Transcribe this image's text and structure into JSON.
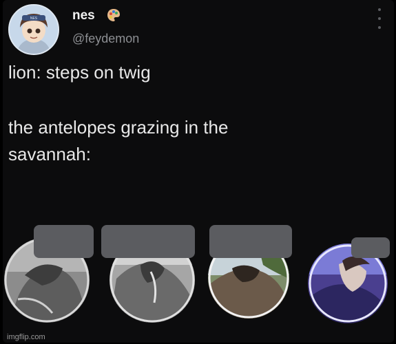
{
  "tweet": {
    "display_name": "nes",
    "name_emoji_icon": "artist-palette-icon",
    "handle": "@feydemon",
    "text_lines": [
      "lion: steps on twig",
      "the antelopes grazing in the",
      "savannah:"
    ]
  },
  "media": {
    "images": [
      {
        "name": "antelope-photo-1",
        "tone": "grayscale"
      },
      {
        "name": "antelope-photo-2",
        "tone": "grayscale"
      },
      {
        "name": "antelope-photo-3",
        "tone": "color-outdoor"
      },
      {
        "name": "antelope-photo-4",
        "tone": "blue-purple"
      }
    ]
  },
  "watermark": "imgflip.com",
  "colors": {
    "background": "#0c0c0d",
    "text": "#e8e8e8",
    "handle": "#8d8f93",
    "censor_box": "#5b5c60"
  }
}
